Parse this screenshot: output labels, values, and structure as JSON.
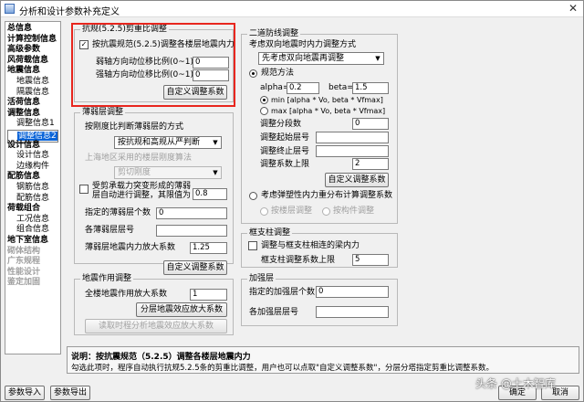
{
  "window": {
    "title": "分析和设计参数补充定义",
    "close_label": "✕"
  },
  "nav": [
    {
      "label": "总信息",
      "level": 0,
      "state": "normal"
    },
    {
      "label": "计算控制信息",
      "level": 0,
      "state": "normal"
    },
    {
      "label": "高级参数",
      "level": 0,
      "state": "normal"
    },
    {
      "label": "风荷载信息",
      "level": 0,
      "state": "normal"
    },
    {
      "label": "地震信息",
      "level": 0,
      "state": "normal"
    },
    {
      "label": "地震信息",
      "level": 1,
      "state": "normal"
    },
    {
      "label": "隔震信息",
      "level": 1,
      "state": "normal"
    },
    {
      "label": "活荷信息",
      "level": 0,
      "state": "normal"
    },
    {
      "label": "调整信息",
      "level": 0,
      "state": "normal"
    },
    {
      "label": "调整信息1",
      "level": 1,
      "state": "normal"
    },
    {
      "label": "调整信息2",
      "level": 1,
      "state": "selected"
    },
    {
      "label": "设计信息",
      "level": 0,
      "state": "normal"
    },
    {
      "label": "设计信息",
      "level": 1,
      "state": "normal"
    },
    {
      "label": "边缘构件",
      "level": 1,
      "state": "normal"
    },
    {
      "label": "配筋信息",
      "level": 0,
      "state": "normal"
    },
    {
      "label": "钢筋信息",
      "level": 1,
      "state": "normal"
    },
    {
      "label": "配筋信息",
      "level": 1,
      "state": "normal"
    },
    {
      "label": "荷载组合",
      "level": 0,
      "state": "normal"
    },
    {
      "label": "工况信息",
      "level": 1,
      "state": "normal"
    },
    {
      "label": "组合信息",
      "level": 1,
      "state": "normal"
    },
    {
      "label": "地下室信息",
      "level": 0,
      "state": "normal"
    },
    {
      "label": "砌体结构",
      "level": 0,
      "state": "disabled"
    },
    {
      "label": "广东规程",
      "level": 0,
      "state": "disabled"
    },
    {
      "label": "性能设计",
      "level": 0,
      "state": "disabled"
    },
    {
      "label": "鉴定加固",
      "level": 0,
      "state": "disabled"
    }
  ],
  "kangnie": {
    "title": "抗规(5.2.5)剪重比调整",
    "check_label": "按抗震规范(5.2.5)调整各楼层地震内力",
    "check_mark": "✓",
    "weak_label": "弱轴方向动位移比例(0~1)",
    "weak_value": "0",
    "strong_label": "强轴方向动位移比例(0~1)",
    "strong_value": "0",
    "button": "自定义调整系数"
  },
  "weak_layer": {
    "title": "薄弱层调整",
    "sub_label": "按刚度比判断薄弱层的方式",
    "method_value": "按抗规和高规从严判断",
    "shanghai_label": "上海地区采用的楼层刚度算法",
    "shanghai_value": "剪切刚度",
    "transfer_check_label_1": "受剪承载力突变形成的薄弱",
    "transfer_check_label_2": "层自动进行调整，其限值为",
    "transfer_value": "0.8",
    "count_label": "指定的薄弱层个数",
    "count_value": "0",
    "layers_label": "各薄弱层层号",
    "layers_value": "",
    "factor_label": "薄弱层地震内力放大系数",
    "factor_value": "1.25",
    "button": "自定义调整系数"
  },
  "seismic_effect": {
    "title": "地震作用调整",
    "factor_label": "全楼地震作用放大系数",
    "factor_value": "1",
    "button1": "分层地震效应放大系数",
    "button2": "读取时程分析地震效应放大系数"
  },
  "two_stage": {
    "title": "二道防线调整",
    "method_label": "考虑双向地震时内力调整方式",
    "method_value": "先考虑双向地震再调整",
    "spec_label": "规范方法",
    "alpha_label": "alpha=",
    "alpha_value": "0.2",
    "beta_label": "beta=",
    "beta_value": "1.5",
    "min_label": "min [alpha * Vo, beta * Vfmax]",
    "max_label": "max [alpha * Vo, beta * Vfmax]",
    "seg_count_label": "调整分段数",
    "seg_count_value": "0",
    "start_label": "调整起始层号",
    "start_value": "",
    "end_label": "调整终止层号",
    "end_value": "",
    "upper_label": "调整系数上限",
    "upper_value": "2",
    "button": "自定义调整系数",
    "plastic_label": "考虑弹塑性内力重分布计算调整系数",
    "by_layer_label": "按楼层调整",
    "by_member_label": "按构件调整"
  },
  "frame_support": {
    "title": "框支柱调整",
    "check_label": "调整与框支柱相连的梁内力",
    "upper_label": "框支柱调整系数上限",
    "upper_value": "5"
  },
  "strengthen": {
    "title": "加强层",
    "count_label": "指定的加强层个数",
    "count_value": "0",
    "layers_label": "各加强层层号",
    "layers_value": ""
  },
  "description": {
    "heading": "说明：按抗震规范（5.2.5）调整各楼层地震内力",
    "body": "勾选此项时，程序自动执行抗规5.2.5条的剪重比调整，用户也可以点取\"自定义调整系数\"，分层分塔指定剪重比调整系数。"
  },
  "footer": {
    "import": "参数导入",
    "export": "参数导出",
    "ok": "确定",
    "cancel": "取消"
  },
  "watermark": "头条 @土木智库",
  "colors": {
    "highlight": "#e8261e",
    "selection": "#0a64d8"
  }
}
